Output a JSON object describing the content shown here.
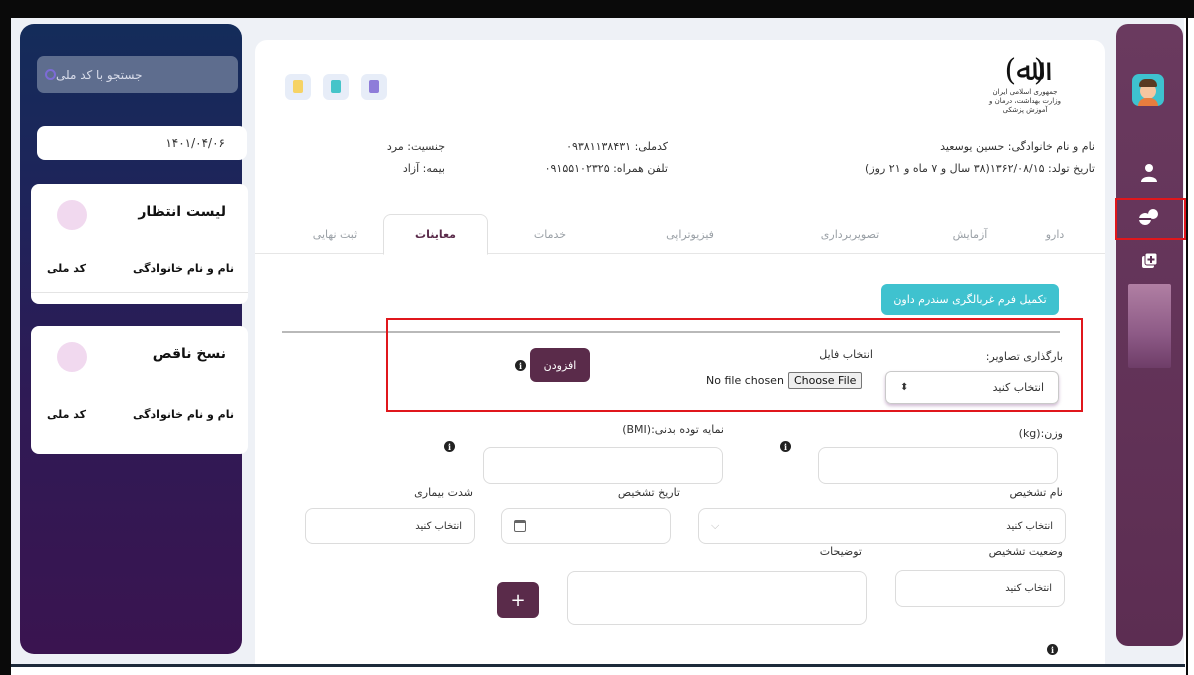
{
  "search": {
    "placeholder": "جستجو با کد ملی"
  },
  "left": {
    "date": "۱۴۰۱/۰۴/۰۶",
    "waiting_list": {
      "title": "لیست انتظار",
      "col_name": "نام و نام خانوادگی",
      "col_id": "کد ملی"
    },
    "incomplete": {
      "title": "نسخ ناقص",
      "col_name": "نام و نام خانوادگی",
      "col_id": "کد ملی"
    }
  },
  "emblem": {
    "line1": "جمهوری اسلامی ایران",
    "line2": "وزارت بهداشت، درمان و آموزش پزشکی"
  },
  "patient": {
    "name": "نام و نام خانوادگی: حسین یوسعید",
    "birth": "تاریخ تولد: ۱۳۶۲/۰۸/۱۵(۳۸ سال و ۷ ماه و ۲۱ روز)",
    "national_id": "کدملی: ۰۹۳۸۱۱۳۸۴۳۱",
    "phone": "تلفن همراه: ۰۹۱۵۵۱۰۲۳۲۵",
    "gender": "جنسیت: مرد",
    "insurance": "بیمه: آزاد"
  },
  "tabs": [
    "دارو",
    "آزمایش",
    "تصویربرداری",
    "فیزیوتراپی",
    "خدمات",
    "معاینات",
    "ثبت نهایی"
  ],
  "active_tab": "معاینات",
  "screening_button": "تکمیل فرم غربالگری سندرم داون",
  "upload": {
    "label": "بارگذاری تصاویر:",
    "select_value": "انتخاب کنید",
    "file_label": "انتخاب فایل",
    "choose_btn": "Choose File",
    "no_file": "No file chosen",
    "add_btn": "افزودن"
  },
  "form": {
    "weight_label": "وزن:(kg)",
    "bmi_label": "نمایه توده بدنی:(BMI)",
    "diagnosis_name_label": "نام تشخیص",
    "diagnosis_name_value": "انتخاب کنید",
    "diagnosis_date_label": "تاریخ تشخیص",
    "severity_label": "شدت بیماری",
    "severity_value": "انتخاب کنید",
    "diagnosis_status_label": "وضعیت تشخیص",
    "diagnosis_status_value": "انتخاب کنید",
    "notes_label": "توضیحات"
  },
  "colors": {
    "primary": "#5a2b4a",
    "teal": "#3fc2cf",
    "highlight": "#e0171c"
  },
  "icons": [
    "prescription-doc-icon",
    "add-doc-icon",
    "clipboard-check-icon",
    "doctor-icon",
    "pills-icon",
    "add-copy-icon",
    "info-icon",
    "calendar-icon",
    "chevron-down-icon",
    "sort-arrows-icon"
  ]
}
